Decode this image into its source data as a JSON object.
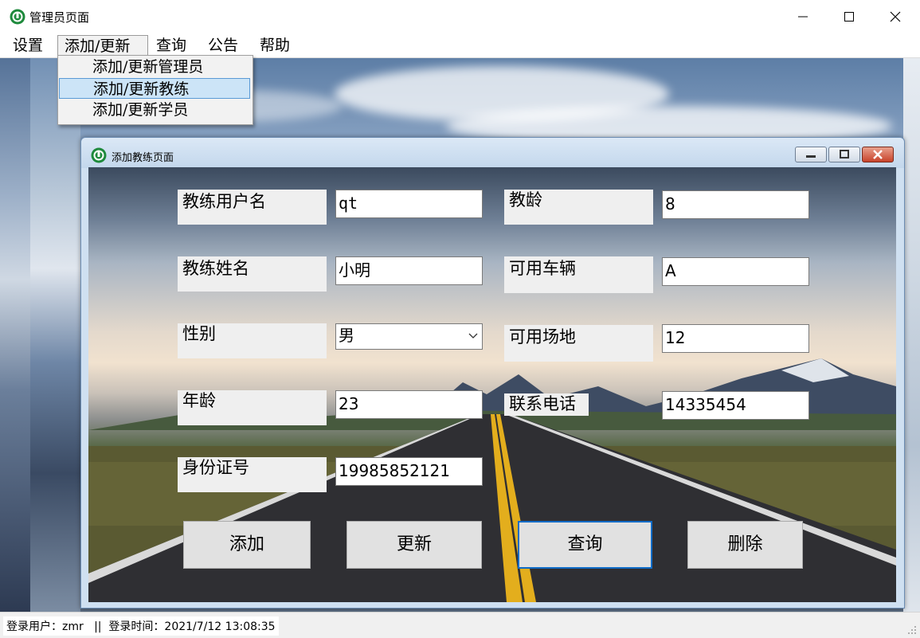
{
  "window": {
    "title": "管理员页面",
    "controls": [
      "minimize-icon",
      "maximize-icon",
      "close-icon"
    ]
  },
  "menubar": {
    "items": [
      {
        "label": "设置"
      },
      {
        "label": "添加/更新",
        "active": true
      },
      {
        "label": "查询"
      },
      {
        "label": "公告"
      },
      {
        "label": "帮助"
      }
    ]
  },
  "dropdown": {
    "items": [
      {
        "label": "添加/更新管理员"
      },
      {
        "label": "添加/更新教练",
        "highlighted": true
      },
      {
        "label": "添加/更新学员"
      }
    ]
  },
  "dialog": {
    "title": "添加教练页面",
    "fields": {
      "username": {
        "label": "教练用户名",
        "value": "qt"
      },
      "name": {
        "label": "教练姓名",
        "value": "小明"
      },
      "gender": {
        "label": "性别",
        "value": "男"
      },
      "age": {
        "label": "年龄",
        "value": "23"
      },
      "id_number": {
        "label": "身份证号",
        "value": "19985852121"
      },
      "teaching_years": {
        "label": "教龄",
        "value": "8"
      },
      "vehicle": {
        "label": "可用车辆",
        "value": "A"
      },
      "venue": {
        "label": "可用场地",
        "value": "12"
      },
      "phone": {
        "label": "联系电话",
        "value": "14335454"
      }
    },
    "buttons": {
      "add": "添加",
      "update": "更新",
      "query": "查询",
      "delete": "删除"
    }
  },
  "statusbar": {
    "text": "登录用户：zmr   ||  登录时间：2021/7/12 13:08:35"
  },
  "colors": {
    "accent": "#0f6cc7",
    "menu_highlight": "#cce4f7",
    "app_icon": "#1e8a3c"
  }
}
